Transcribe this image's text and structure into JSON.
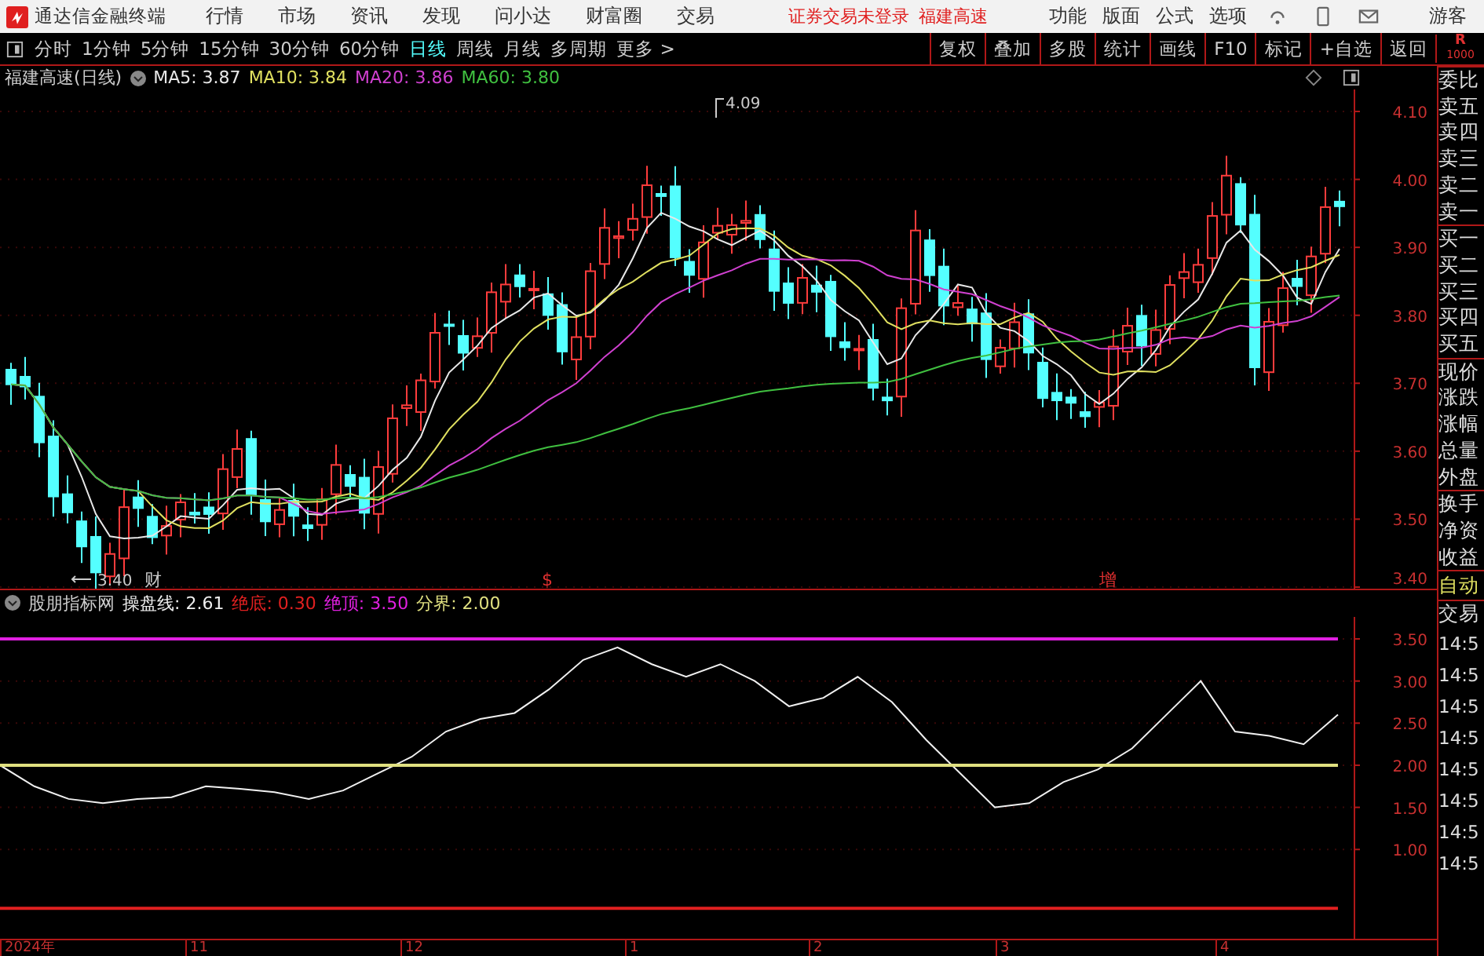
{
  "app": {
    "title": "通达信金融终端"
  },
  "menu": [
    "行情",
    "市场",
    "资讯",
    "发现",
    "问小达",
    "财富圈",
    "交易"
  ],
  "status_notice": [
    "证券交易未登录",
    "福建高速"
  ],
  "menu_right": [
    "功能",
    "版面",
    "公式",
    "选项"
  ],
  "user": "游客",
  "periods": [
    {
      "label": "分时",
      "selected": false
    },
    {
      "label": "1分钟",
      "selected": false
    },
    {
      "label": "5分钟",
      "selected": false
    },
    {
      "label": "15分钟",
      "selected": false
    },
    {
      "label": "30分钟",
      "selected": false
    },
    {
      "label": "60分钟",
      "selected": false
    },
    {
      "label": "日线",
      "selected": true
    },
    {
      "label": "周线",
      "selected": false
    },
    {
      "label": "月线",
      "selected": false
    },
    {
      "label": "多周期",
      "selected": false
    },
    {
      "label": "更多 >",
      "selected": false
    }
  ],
  "tools": [
    "复权",
    "叠加",
    "多股",
    "统计",
    "画线",
    "F10",
    "标记",
    "+自选",
    "返回"
  ],
  "corner": [
    "R",
    "1000"
  ],
  "price_chart": {
    "title": "福建高速(日线)",
    "ma": [
      {
        "label": "MA5: 3.87",
        "color": "#e8e8e8"
      },
      {
        "label": "MA10: 3.84",
        "color": "#e0e060"
      },
      {
        "label": "MA20: 3.86",
        "color": "#d040d0"
      },
      {
        "label": "MA60: 3.80",
        "color": "#40c040"
      }
    ],
    "high_label": "4.09",
    "low_label": "3.40",
    "markers": [
      {
        "text": "财",
        "color": "#c8c8c8"
      },
      {
        "text": "$",
        "color": "#e03030"
      },
      {
        "text": "增",
        "color": "#e03030"
      }
    ],
    "yticks": [
      "4.10",
      "4.00",
      "3.90",
      "3.80",
      "3.70",
      "3.60",
      "3.50",
      "3.40"
    ]
  },
  "indicator": {
    "name": "股朋指标网",
    "separator": ":",
    "legend_values": [
      "2.61",
      "0.30",
      "3.50",
      "2.00"
    ],
    "chart_data": {
      "type": "line",
      "ylim": [
        -0.06,
        3.75
      ],
      "grid": true,
      "yticks": [
        {
          "value": 3.5,
          "label": "3.50"
        },
        {
          "value": 3,
          "label": "3.00"
        },
        {
          "value": 2.5,
          "label": "2.50"
        },
        {
          "value": 2,
          "label": "2.00"
        },
        {
          "value": 1.5,
          "label": "1.50"
        },
        {
          "value": 1,
          "label": "1.00"
        }
      ],
      "series": [
        {
          "name": "操盘线",
          "color": "#f0f0f0",
          "values": [
            2.0,
            1.75,
            1.6,
            1.55,
            1.6,
            1.62,
            1.75,
            1.72,
            1.68,
            1.6,
            1.7,
            1.9,
            2.1,
            2.4,
            2.55,
            2.62,
            2.9,
            3.25,
            3.4,
            3.2,
            3.05,
            3.2,
            3.0,
            2.7,
            2.8,
            3.05,
            2.75,
            2.3,
            1.9,
            1.5,
            1.55,
            1.8,
            1.95,
            2.2,
            2.6,
            3.0,
            2.4,
            2.35,
            2.25,
            2.6
          ]
        },
        {
          "name": "绝底",
          "color": "#e02020",
          "values": [
            0.3,
            0.3,
            0.3,
            0.3,
            0.3,
            0.3,
            0.3,
            0.3,
            0.3,
            0.3,
            0.3,
            0.3,
            0.3,
            0.3,
            0.3,
            0.3,
            0.3,
            0.3,
            0.3,
            0.3,
            0.3,
            0.3,
            0.3,
            0.3,
            0.3,
            0.3,
            0.3,
            0.3,
            0.3,
            0.3,
            0.3,
            0.3,
            0.3,
            0.3,
            0.3,
            0.3,
            0.3,
            0.3,
            0.3,
            0.3
          ]
        },
        {
          "name": "绝顶",
          "color": "#e020e0",
          "values": [
            3.5,
            3.5,
            3.5,
            3.5,
            3.5,
            3.5,
            3.5,
            3.5,
            3.5,
            3.5,
            3.5,
            3.5,
            3.5,
            3.5,
            3.5,
            3.5,
            3.5,
            3.5,
            3.5,
            3.5,
            3.5,
            3.5,
            3.5,
            3.5,
            3.5,
            3.5,
            3.5,
            3.5,
            3.5,
            3.5,
            3.5,
            3.5,
            3.5,
            3.5,
            3.5,
            3.5,
            3.5,
            3.5,
            3.5,
            3.5
          ]
        },
        {
          "name": "分界",
          "color": "#e0e080",
          "values": [
            2.0,
            2.0,
            2.0,
            2.0,
            2.0,
            2.0,
            2.0,
            2.0,
            2.0,
            2.0,
            2.0,
            2.0,
            2.0,
            2.0,
            2.0,
            2.0,
            2.0,
            2.0,
            2.0,
            2.0,
            2.0,
            2.0,
            2.0,
            2.0,
            2.0,
            2.0,
            2.0,
            2.0,
            2.0,
            2.0,
            2.0,
            2.0,
            2.0,
            2.0,
            2.0,
            2.0,
            2.0,
            2.0,
            2.0,
            2.0
          ]
        }
      ]
    }
  },
  "date_axis": [
    "2024年",
    "11",
    "12",
    "1",
    "2",
    "3",
    "4"
  ],
  "quote_panel": [
    {
      "label": "委比",
      "kind": "head"
    },
    {
      "label": "卖五",
      "kind": "item"
    },
    {
      "label": "卖四",
      "kind": "item"
    },
    {
      "label": "卖三",
      "kind": "item"
    },
    {
      "label": "卖二",
      "kind": "item"
    },
    {
      "label": "卖一",
      "kind": "item"
    },
    {
      "label": "买一",
      "kind": "head"
    },
    {
      "label": "买二",
      "kind": "item"
    },
    {
      "label": "买三",
      "kind": "item"
    },
    {
      "label": "买四",
      "kind": "item"
    },
    {
      "label": "买五",
      "kind": "item"
    },
    {
      "label": "现价",
      "kind": "head"
    },
    {
      "label": "涨跌",
      "kind": "item"
    },
    {
      "label": "涨幅",
      "kind": "item"
    },
    {
      "label": "总量",
      "kind": "item"
    },
    {
      "label": "外盘",
      "kind": "item"
    },
    {
      "label": "换手",
      "kind": "head"
    },
    {
      "label": "净资",
      "kind": "item"
    },
    {
      "label": "收益",
      "kind": "item"
    },
    {
      "label": "自动",
      "kind": "accent"
    },
    {
      "label": "交易",
      "kind": "head"
    }
  ],
  "trade_times": [
    "14:5",
    "14:5",
    "14:5",
    "14:5",
    "14:5",
    "14:5",
    "14:5",
    "14:5"
  ]
}
